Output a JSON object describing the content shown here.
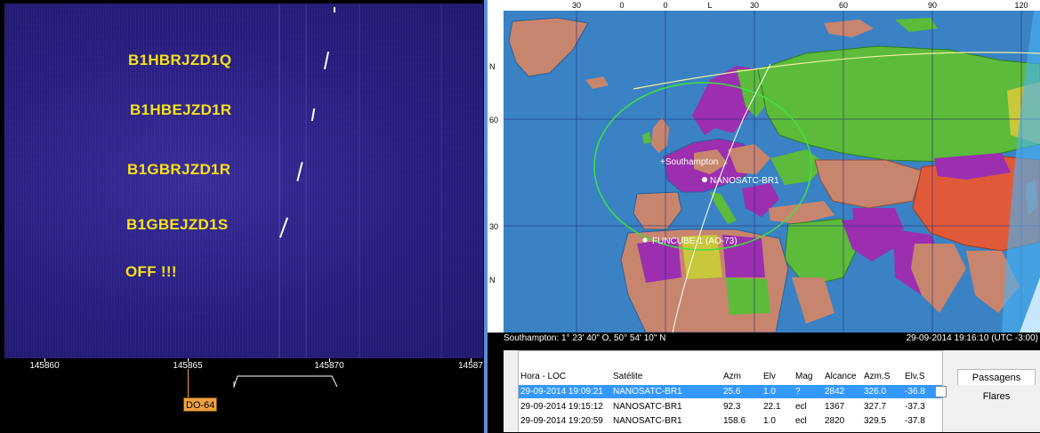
{
  "waterfall": {
    "labels": [
      "B1HBRJZD1Q",
      "B1HBEJZD1R",
      "B1GBRJZD1R",
      "B1GBEJZD1S",
      "OFF !!!"
    ],
    "freq_ticks": [
      "145860",
      "145865",
      "145870",
      "14587"
    ],
    "marker_label": "DO-64",
    "colors": {
      "background": "#2a1f86",
      "label": "#f5e21a",
      "marker": "#f0a040"
    }
  },
  "map": {
    "lon_labels": [
      "30",
      "0",
      "0",
      "L",
      "30",
      "60",
      "90",
      "120"
    ],
    "lat_labels": [
      "N",
      "60",
      "30",
      "N"
    ],
    "places": {
      "observer": "+Southampton",
      "sat_primary": "NANOSATC-BR1",
      "sat_secondary": "FUNCUBE-1 (AO-73)"
    },
    "status_left": "Southampton: 1° 23' 40\" O, 50° 54' 10\" N",
    "status_right": "29-09-2014 19:16:10 (UTC -3:00)",
    "colors": {
      "ocean": "#3a82c4",
      "footprint": "#40e040",
      "track": "#f0f0a0"
    }
  },
  "passes": {
    "headers": {
      "hora": "Hora - LOC",
      "satelite": "Satélite",
      "azm": "Azm",
      "elv": "Elv",
      "mag": "Mag",
      "alcance": "Alcance",
      "azm_s": "Azm.S",
      "elv_s": "Elv.S"
    },
    "rows": [
      {
        "hora": "29-09-2014 19:09:21",
        "satelite": "NANOSATC-BR1",
        "azm": "25.6",
        "elv": "1.0",
        "mag": "?",
        "alcance": "2842",
        "azm_s": "326.0",
        "elv_s": "-36.8"
      },
      {
        "hora": "29-09-2014 19:15:12",
        "satelite": "NANOSATC-BR1",
        "azm": "92.3",
        "elv": "22.1",
        "mag": "ecl",
        "alcance": "1367",
        "azm_s": "327.7",
        "elv_s": "-37.3"
      },
      {
        "hora": "29-09-2014 19:20:59",
        "satelite": "NANOSATC-BR1",
        "azm": "158.6",
        "elv": "1.0",
        "mag": "ecl",
        "alcance": "2820",
        "azm_s": "329.5",
        "elv_s": "-37.8"
      }
    ],
    "buttons": {
      "passagens": "Passagens",
      "flares": "Flares"
    },
    "colors": {
      "selected_row": "#3399ff"
    }
  }
}
